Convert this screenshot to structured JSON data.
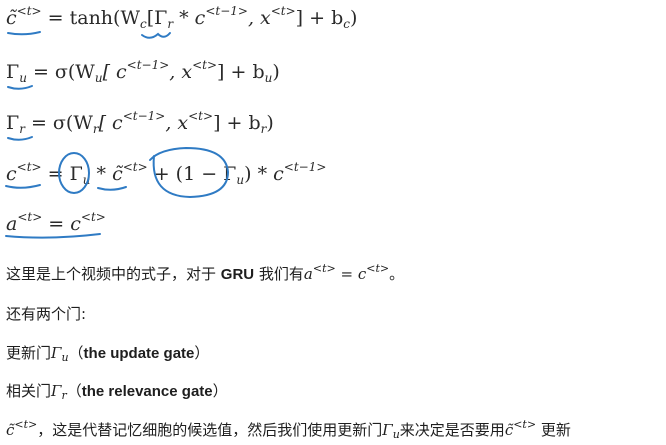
{
  "equations": {
    "eq1": {
      "lhs": "c̃",
      "sup": "<t>",
      "rhs": "= tanh(W",
      "rhs_sub": "c",
      "bracket_open": "[Γ",
      "g_sub": "r",
      "star": " * c",
      "sup2": "<t−1>",
      "mid": ", x",
      "sup3": "<t>",
      "tail": "] + b",
      "tail_sub": "c",
      "close": ")"
    },
    "eq2": {
      "lhs": "Γ",
      "lhs_sub": "u",
      "rhs": " = σ(W",
      "w_sub": "u",
      "bracket": "[ c",
      "sup1": "<t−1>",
      "mid": ", x",
      "sup2": "<t>",
      "tail": "] + b",
      "tail_sub": "u",
      "close": ")"
    },
    "eq3": {
      "lhs": "Γ",
      "lhs_sub": "r",
      "rhs": " = σ(W",
      "w_sub": "r",
      "bracket": "[ c",
      "sup1": "<t−1>",
      "mid": ", x",
      "sup2": "<t>",
      "tail": "] + b",
      "tail_sub": "r",
      "close": ")"
    },
    "eq4": {
      "lhs": "c",
      "sup": "<t>",
      "eq": " = ",
      "g": "Γ",
      "g_sub": "u",
      "star1": " * c̃",
      "sup2": "<t>",
      "plus": " + (1 − Γ",
      "g2_sub": "u",
      "close": ")",
      "star2": " * c",
      "sup3": "<t−1>"
    },
    "eq5": {
      "lhs": "a",
      "sup": "<t>",
      "eq": " = c",
      "sup2": "<t>"
    }
  },
  "text": {
    "line1_pre": "这里是上个视频中的式子，对于 ",
    "line1_bold": "GRU",
    "line1_mid": " 我们有",
    "line1_a": "a",
    "line1_sup": "<t>",
    "line1_eq": " = c",
    "line1_sup2": "<t>",
    "line1_end": "。",
    "line2": "还有两个门:",
    "line3_pre": "更新门",
    "line3_gamma": "Γ",
    "line3_sub": "u",
    "line3_paren_open": "（",
    "line3_bold": "the update gate",
    "line3_paren_close": "）",
    "line4_pre": "相关门",
    "line4_gamma": "Γ",
    "line4_sub": "r",
    "line4_paren_open": "（",
    "line4_bold": "the relevance gate",
    "line4_paren_close": "）",
    "line5_c": "c̃",
    "line5_sup": "<t>",
    "line5_mid": "，这是代替记忆细胞的候选值，然后我们使用更新门",
    "line5_gamma": "Γ",
    "line5_sub": "u",
    "line5_mid2": "来决定是否要用",
    "line5_c2": "c̃",
    "line5_sup2": "<t>",
    "line5_end": " 更新"
  },
  "colors": {
    "ink": "#2f7bc4",
    "text": "#1e1e1e"
  }
}
